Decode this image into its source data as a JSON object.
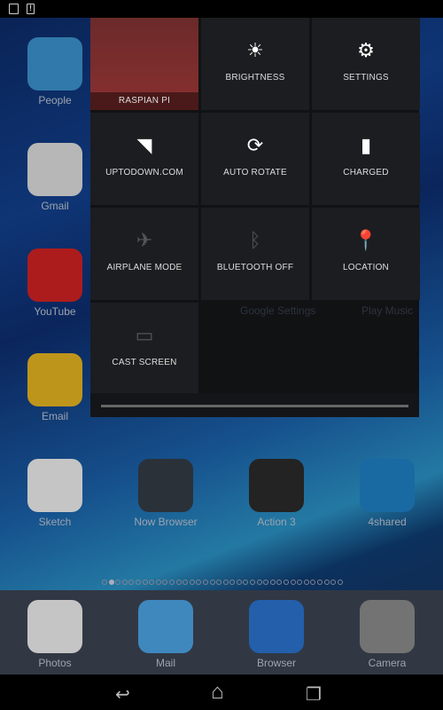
{
  "status_bar": {
    "icons": [
      "image-icon",
      "alert-icon"
    ]
  },
  "home": {
    "left_column": [
      {
        "label": "People",
        "icon": "contacts-icon",
        "color": "#3a8fc8"
      },
      {
        "label": "Gmail",
        "icon": "gmail-icon",
        "color": "#d8d8d8"
      },
      {
        "label": "YouTube",
        "icon": "youtube-icon",
        "color": "#cc2222"
      },
      {
        "label": "Email",
        "icon": "email-icon",
        "color": "#e0b020"
      }
    ],
    "row": [
      {
        "label": "Sketch",
        "icon": "sketch-icon",
        "color": "#e8e8e8"
      },
      {
        "label": "Now Browser",
        "icon": "globe-icon",
        "color": "#333a44"
      },
      {
        "label": "Action 3",
        "icon": "list-icon",
        "color": "#2a2a2a"
      },
      {
        "label": "4shared",
        "icon": "four-icon",
        "color": "#1e7cc0"
      }
    ],
    "hidden_labels": [
      "Google Settings",
      "Play Music"
    ],
    "page_count": 36,
    "active_page": 2
  },
  "dock": [
    {
      "label": "Photos",
      "icon": "photos-icon",
      "color": "#e8e8e8"
    },
    {
      "label": "Mail",
      "icon": "mail-icon",
      "color": "#4aa0e0"
    },
    {
      "label": "Browser",
      "icon": "compass-icon",
      "color": "#2a70c8"
    },
    {
      "label": "Camera",
      "icon": "camera-icon",
      "color": "#888"
    }
  ],
  "quick_settings": {
    "tiles": [
      {
        "label": "RASPIAN PI",
        "icon": "user-avatar"
      },
      {
        "label": "BRIGHTNESS",
        "icon": "brightness-icon",
        "glyph": "☀"
      },
      {
        "label": "SETTINGS",
        "icon": "gear-icon",
        "glyph": "⚙"
      },
      {
        "label": "UPTODOWN.COM",
        "icon": "wifi-icon",
        "glyph": "◥"
      },
      {
        "label": "AUTO ROTATE",
        "icon": "rotate-icon",
        "glyph": "⟳"
      },
      {
        "label": "CHARGED",
        "icon": "battery-icon",
        "glyph": "▮"
      },
      {
        "label": "AIRPLANE MODE",
        "icon": "airplane-icon",
        "glyph": "✈",
        "off": true
      },
      {
        "label": "BLUETOOTH OFF",
        "icon": "bluetooth-icon",
        "glyph": "ᛒ",
        "off": true
      },
      {
        "label": "LOCATION",
        "icon": "location-pin-icon",
        "glyph": "📍"
      },
      {
        "label": "CAST SCREEN",
        "icon": "cast-icon",
        "glyph": "▭",
        "off": true
      }
    ]
  },
  "nav": {
    "back": "↩",
    "home": "⌂",
    "recents": "❐"
  }
}
